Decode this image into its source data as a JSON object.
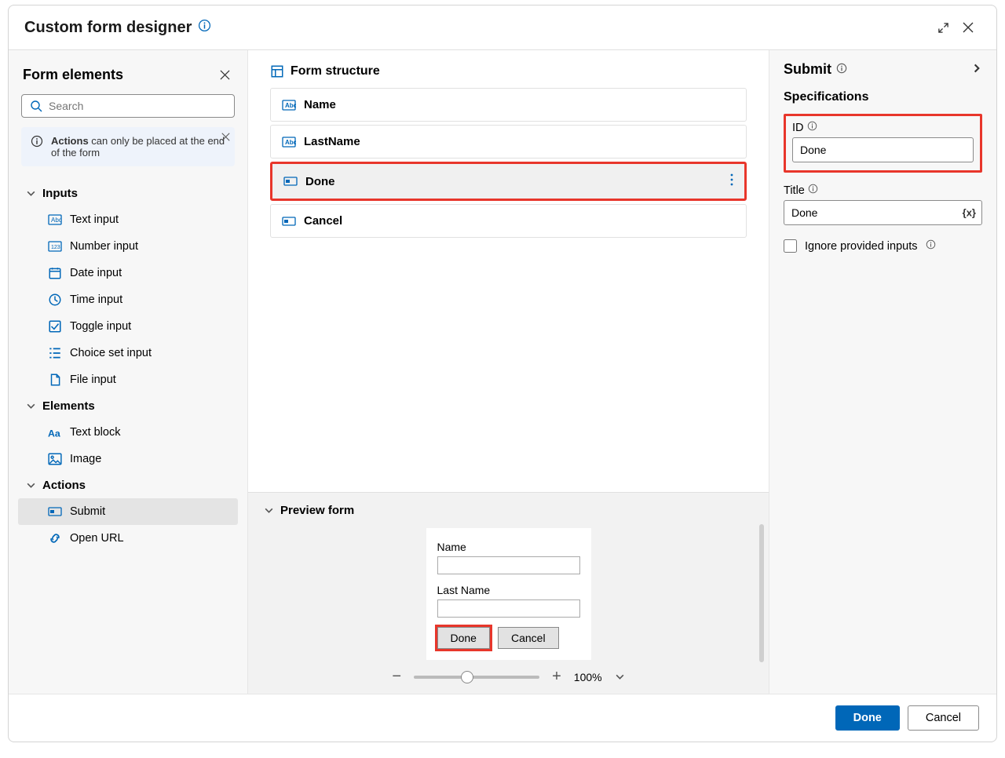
{
  "title": "Custom form designer",
  "sidebar": {
    "title": "Form elements",
    "search_placeholder": "Search",
    "notice_strong": "Actions",
    "notice_rest": " can only be placed at the end of the form",
    "groups": {
      "inputs": {
        "label": "Inputs",
        "items": [
          "Text input",
          "Number input",
          "Date input",
          "Time input",
          "Toggle input",
          "Choice set input",
          "File input"
        ]
      },
      "elements": {
        "label": "Elements",
        "items": [
          "Text block",
          "Image"
        ]
      },
      "actions": {
        "label": "Actions",
        "items": [
          "Submit",
          "Open URL"
        ]
      }
    }
  },
  "structure": {
    "title": "Form structure",
    "rows": [
      {
        "label": "Name",
        "kind": "text"
      },
      {
        "label": "LastName",
        "kind": "text"
      },
      {
        "label": "Done",
        "kind": "action",
        "selected": true
      },
      {
        "label": "Cancel",
        "kind": "action"
      }
    ]
  },
  "preview": {
    "title": "Preview form",
    "fields": [
      {
        "label": "Name"
      },
      {
        "label": "Last Name"
      }
    ],
    "buttons": {
      "done": "Done",
      "cancel": "Cancel"
    },
    "zoom": "100%"
  },
  "props": {
    "header": "Submit",
    "spec_label": "Specifications",
    "id_label": "ID",
    "id_value": "Done",
    "title_label": "Title",
    "title_value": "Done",
    "ignore_label": "Ignore provided inputs"
  },
  "footer": {
    "done": "Done",
    "cancel": "Cancel"
  }
}
